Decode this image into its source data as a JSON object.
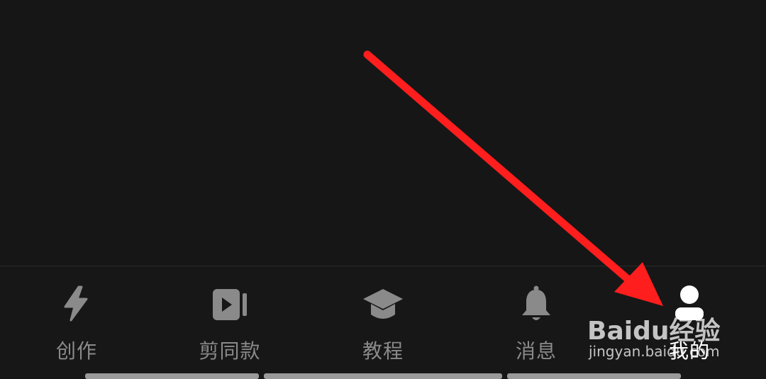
{
  "tabs": [
    {
      "id": "create",
      "label": "创作",
      "icon": "lightning-icon",
      "active": false
    },
    {
      "id": "template",
      "label": "剪同款",
      "icon": "video-template-icon",
      "active": false
    },
    {
      "id": "tutorial",
      "label": "教程",
      "icon": "graduation-cap-icon",
      "active": false
    },
    {
      "id": "messages",
      "label": "消息",
      "icon": "bell-icon",
      "active": false
    },
    {
      "id": "me",
      "label": "我的",
      "icon": "person-icon",
      "active": true
    }
  ],
  "colors": {
    "background": "#161616",
    "inactive": "#8a8a8a",
    "active": "#ffffff",
    "arrow": "#ff1e1e"
  },
  "watermark": {
    "logo": "Baidu经验",
    "url": "jingyan.baidu.com"
  }
}
